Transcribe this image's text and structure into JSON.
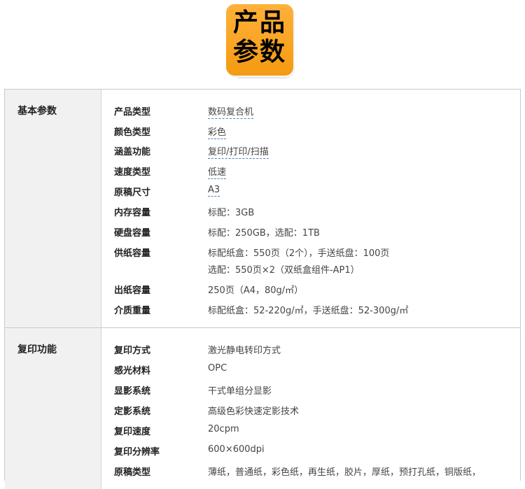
{
  "header": {
    "badge_line1": "产品",
    "badge_line2": "参数",
    "badge_color": "#f7a11e"
  },
  "sections": [
    {
      "title": "基本参数",
      "rows": [
        {
          "label": "产品类型",
          "value": "数码复合机",
          "linked": true
        },
        {
          "label": "颜色类型",
          "value": "彩色",
          "linked": true
        },
        {
          "label": "涵盖功能",
          "value": "复印/打印/扫描",
          "linked": true
        },
        {
          "label": "速度类型",
          "value": "低速",
          "linked": true
        },
        {
          "label": "原稿尺寸",
          "value": "A3",
          "linked": true
        },
        {
          "label": "内存容量",
          "value": "标配：3GB"
        },
        {
          "label": "硬盘容量",
          "value": "标配：250GB，选配：1TB"
        },
        {
          "label": "供纸容量",
          "value": "标配纸盒：550页（2个），手送纸盘：100页",
          "value2": "选配：550页×2（双纸盒组件-AP1）"
        },
        {
          "label": "出纸容量",
          "value": "250页（A4，80g/㎡）"
        },
        {
          "label": "介质重量",
          "value": "标配纸盒：52-220g/㎡，手送纸盘：52-300g/㎡"
        }
      ]
    },
    {
      "title": "复印功能",
      "rows": [
        {
          "label": "复印方式",
          "value": "激光静电转印方式"
        },
        {
          "label": "感光材料",
          "value": "OPC"
        },
        {
          "label": "显影系统",
          "value": "干式单组分显影"
        },
        {
          "label": "定影系统",
          "value": "高级色彩快速定影技术"
        },
        {
          "label": "复印速度",
          "value": "20cpm"
        },
        {
          "label": "复印分辨率",
          "value": "600×600dpi"
        },
        {
          "label": "原稿类型",
          "value": "薄纸，普通纸，彩色纸，再生纸，胶片，厚纸，预打孔纸，铜版纸，"
        }
      ]
    }
  ],
  "colors": {
    "label_bg": "#f1f1f1",
    "border": "#c9c9c9",
    "link_underline": "#5a7fb8"
  }
}
